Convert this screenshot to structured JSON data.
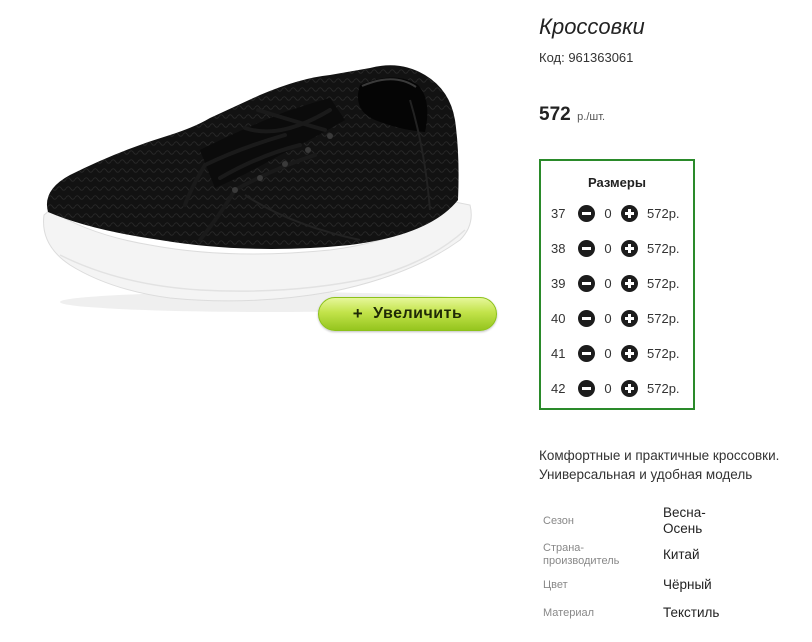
{
  "product": {
    "title": "Кроссовки",
    "code": "Код: 961363061",
    "price": "572",
    "price_unit": "р./шт.",
    "zoom_button": "Увеличить",
    "zoom_plus": "+"
  },
  "sizes": {
    "title": "Размеры",
    "rows": [
      {
        "size": "37",
        "qty": "0",
        "price": "572р."
      },
      {
        "size": "38",
        "qty": "0",
        "price": "572р."
      },
      {
        "size": "39",
        "qty": "0",
        "price": "572р."
      },
      {
        "size": "40",
        "qty": "0",
        "price": "572р."
      },
      {
        "size": "41",
        "qty": "0",
        "price": "572р."
      },
      {
        "size": "42",
        "qty": "0",
        "price": "572р."
      }
    ]
  },
  "description": {
    "line1": "Комфортные и практичные кроссовки.",
    "line2": "Универсальная и удобная модель"
  },
  "attributes": [
    {
      "label": "Сезон",
      "value_line1": "Весна-",
      "value_line2": "Осень"
    },
    {
      "label_line1": "Страна-",
      "label_line2": "производитель",
      "value": "Китай"
    },
    {
      "label": "Цвет",
      "value": "Чёрный"
    },
    {
      "label": "Материал",
      "value": "Текстиль"
    }
  ]
}
